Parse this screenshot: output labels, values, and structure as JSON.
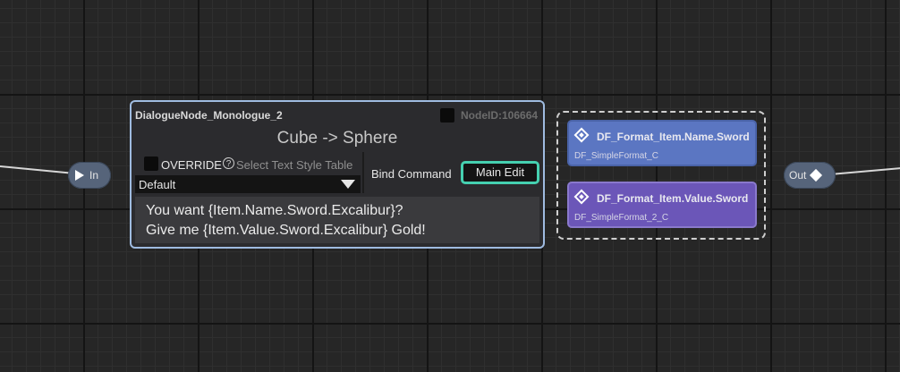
{
  "graph": {
    "in_pin_label": "In",
    "out_pin_label": "Out"
  },
  "dialogue_node": {
    "name": "DialogueNode_Monologue_2",
    "node_id": "NodeID:106664",
    "title": "Cube -> Sphere",
    "override_label": "OVERRIDE",
    "text_style_placeholder": "Select Text Style Table",
    "style_value": "Default",
    "bind_command_label": "Bind Command",
    "main_edit_label": "Main Edit",
    "text_line1": "You want {Item.Name.Sword.Excalibur}?",
    "text_line2": "Give me {Item.Value.Sword.Excalibur} Gold!"
  },
  "format_nodes": [
    {
      "name": "DF_Format_Item.Name.Sword",
      "class": "DF_SimpleFormat_C"
    },
    {
      "name": "DF_Format_Item.Value.Sword",
      "class": "DF_SimpleFormat_2_C"
    }
  ]
}
